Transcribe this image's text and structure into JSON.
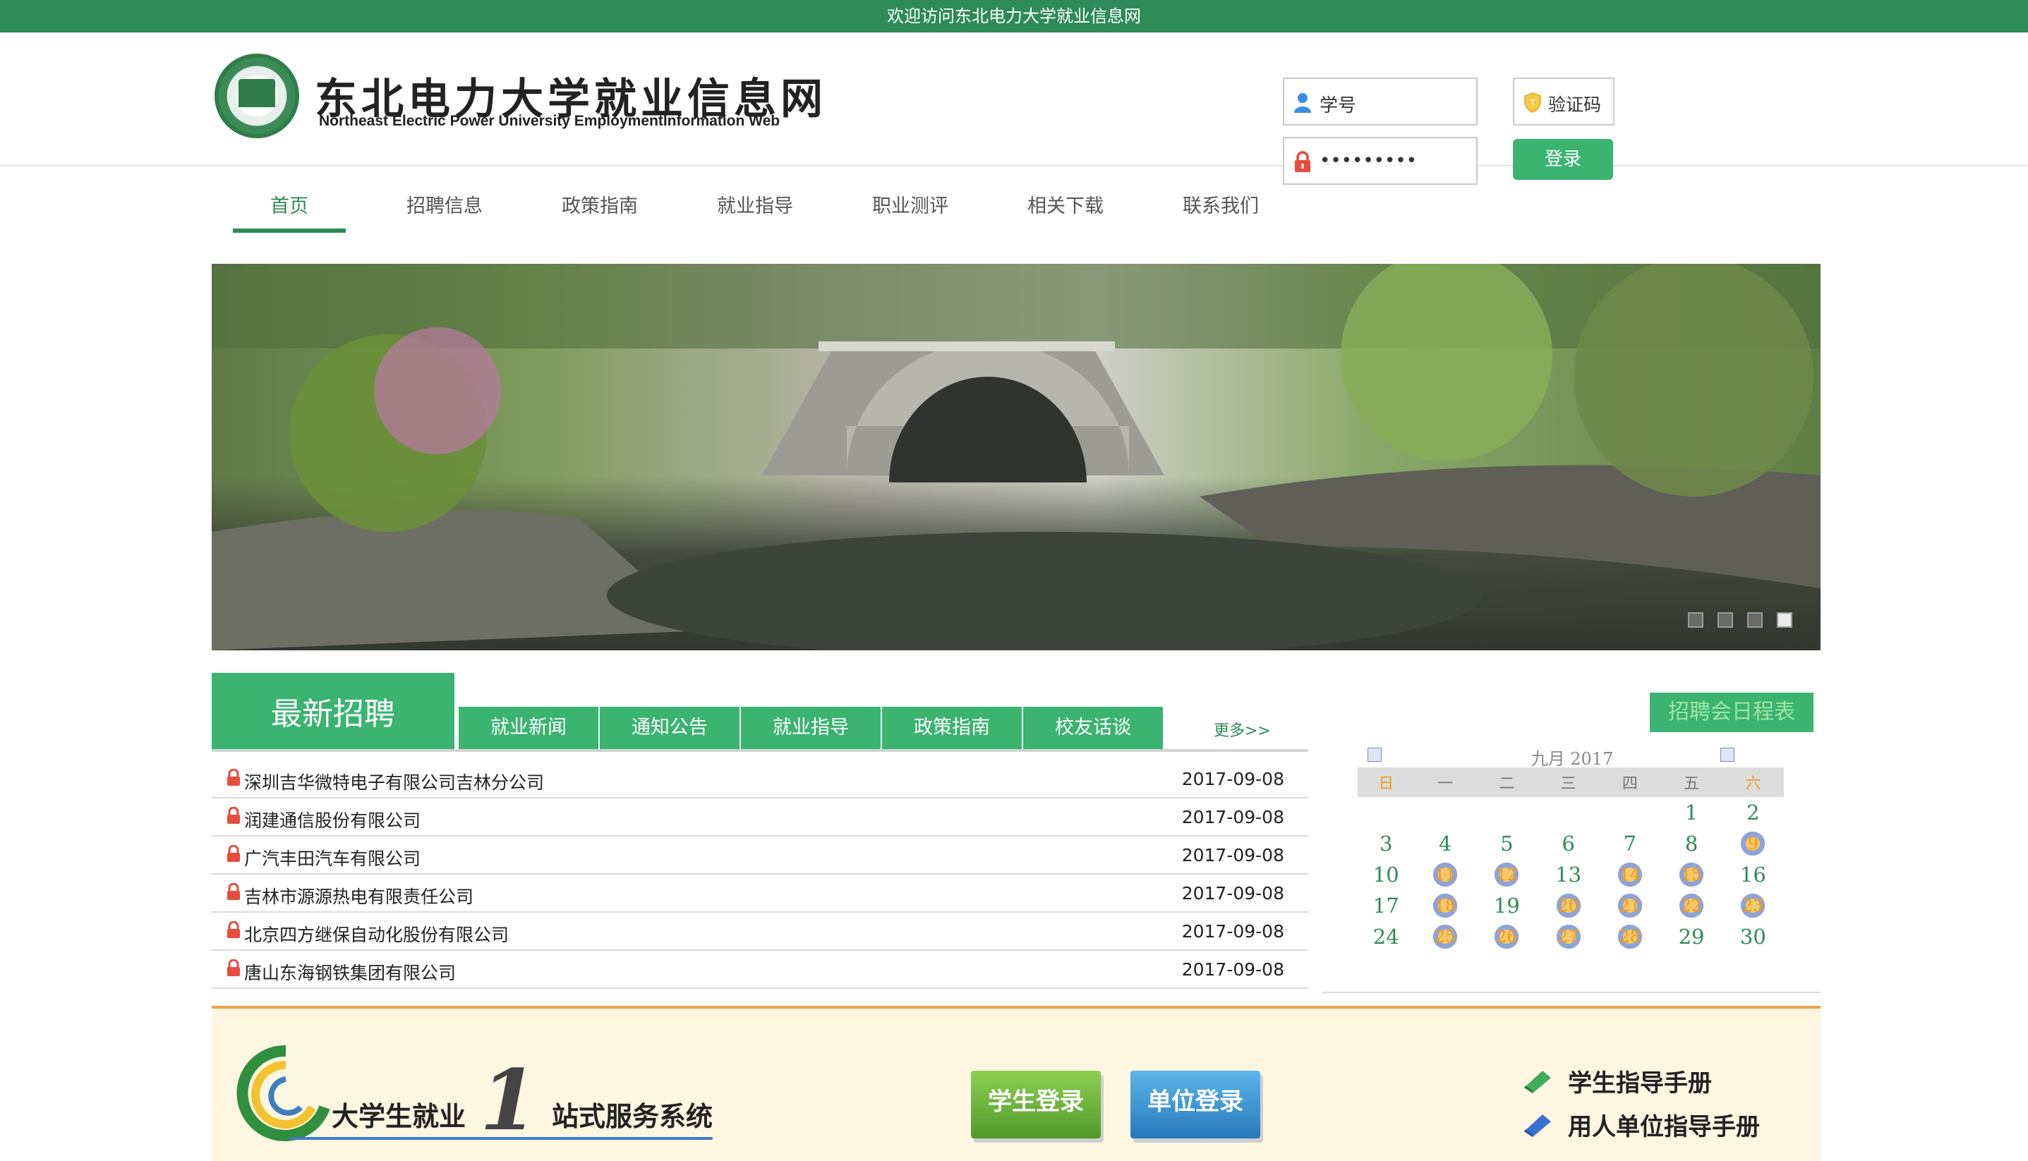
{
  "topbar": {
    "welcome": "欢迎访问东北电力大学就业信息网"
  },
  "header": {
    "site_title_cn": "东北电力大学就业信息网",
    "site_title_en": "Northeast Electric Power University EmploymentInformation Web",
    "login": {
      "student_id_placeholder": "学号",
      "password_masked": "•••••••••",
      "captcha_placeholder": "验证码",
      "login_button": "登录"
    }
  },
  "nav": {
    "items": [
      {
        "label": "首页",
        "active": true
      },
      {
        "label": "招聘信息"
      },
      {
        "label": "政策指南"
      },
      {
        "label": "就业指导"
      },
      {
        "label": "职业测评"
      },
      {
        "label": "相关下载"
      },
      {
        "label": "联系我们"
      }
    ]
  },
  "banner": {
    "slides": 4,
    "active_slide": 4
  },
  "news": {
    "main_tab": "最新招聘",
    "tabs": [
      "就业新闻",
      "通知公告",
      "就业指导",
      "政策指南",
      "校友话谈"
    ],
    "more": "更多>>",
    "rows": [
      {
        "name": "深圳吉华微特电子有限公司吉林分公司",
        "date": "2017-09-08"
      },
      {
        "name": "润建通信股份有限公司",
        "date": "2017-09-08"
      },
      {
        "name": "广汽丰田汽车有限公司",
        "date": "2017-09-08"
      },
      {
        "name": "吉林市源源热电有限责任公司",
        "date": "2017-09-08"
      },
      {
        "name": "北京四方继保自动化股份有限公司",
        "date": "2017-09-08"
      },
      {
        "name": "唐山东海钢铁集团有限公司",
        "date": "2017-09-08"
      }
    ]
  },
  "calendar": {
    "button": "招聘会日程表",
    "title": "九月 2017",
    "weekdays": [
      "日",
      "一",
      "二",
      "三",
      "四",
      "五",
      "六"
    ],
    "weeks": [
      [
        "",
        "",
        "",
        "",
        "",
        "1",
        "2"
      ],
      [
        "3",
        "4",
        "5",
        "6",
        "7",
        "8",
        "9"
      ],
      [
        "10",
        "11",
        "12",
        "13",
        "14",
        "15",
        "16"
      ],
      [
        "17",
        "18",
        "19",
        "20",
        "21",
        "22",
        "23"
      ],
      [
        "24",
        "25",
        "26",
        "27",
        "28",
        "29",
        "30"
      ]
    ],
    "event_days": [
      "9",
      "11",
      "12",
      "14",
      "15",
      "18",
      "20",
      "21",
      "22",
      "23",
      "25",
      "26",
      "27",
      "28"
    ]
  },
  "footer": {
    "system_title_1": "大学生就业",
    "system_title_one": "1",
    "system_title_2": "站式服务系统",
    "student_login": "学生登录",
    "org_login": "单位登录",
    "student_guide": "学生指导手册",
    "employer_guide": "用人单位指导手册"
  },
  "colors": {
    "brand": "#2e8b57",
    "tab": "#3bb371",
    "accent": "#f39c12"
  }
}
